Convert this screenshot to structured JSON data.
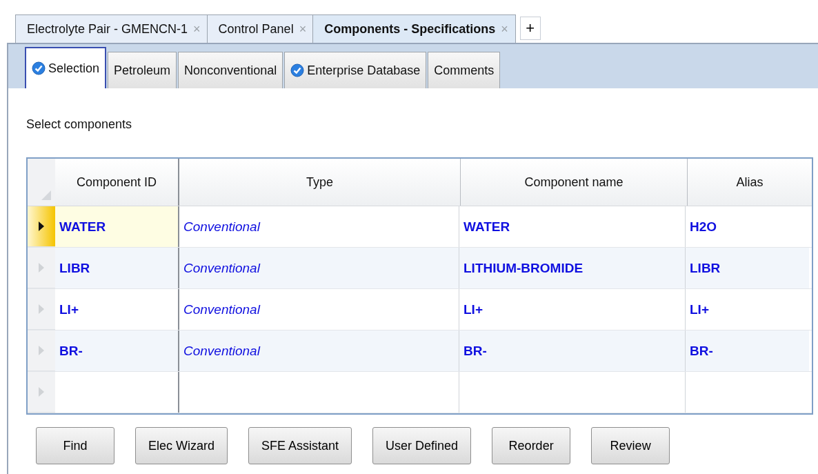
{
  "document_tabs": [
    {
      "label": "Electrolyte Pair - GMENCN-1",
      "selected": false,
      "close": "×"
    },
    {
      "label": "Control Panel",
      "selected": false,
      "close": "×"
    },
    {
      "label": "Components - Specifications",
      "selected": true,
      "close": "×"
    }
  ],
  "new_tab": "+",
  "form_tabs": [
    {
      "label": "Selection",
      "selected": true,
      "checked": true
    },
    {
      "label": "Petroleum",
      "selected": false,
      "checked": false
    },
    {
      "label": "Nonconventional",
      "selected": false,
      "checked": false
    },
    {
      "label": "Enterprise Database",
      "selected": false,
      "checked": true
    },
    {
      "label": "Comments",
      "selected": false,
      "checked": false
    }
  ],
  "section_label": "Select components",
  "table": {
    "columns": [
      "Component ID",
      "Type",
      "Component name",
      "Alias"
    ],
    "rows": [
      {
        "selected": true,
        "cells": [
          "WATER",
          "Conventional",
          "WATER",
          "H2O"
        ]
      },
      {
        "selected": false,
        "cells": [
          "LIBR",
          "Conventional",
          "LITHIUM-BROMIDE",
          "LIBR"
        ]
      },
      {
        "selected": false,
        "cells": [
          "LI+",
          "Conventional",
          "LI+",
          "LI+"
        ]
      },
      {
        "selected": false,
        "cells": [
          "BR-",
          "Conventional",
          "BR-",
          "BR-"
        ]
      }
    ],
    "new_row": true
  },
  "buttons": [
    "Find",
    "Elec Wizard",
    "SFE Assistant",
    "User Defined",
    "Reorder",
    "Review"
  ]
}
